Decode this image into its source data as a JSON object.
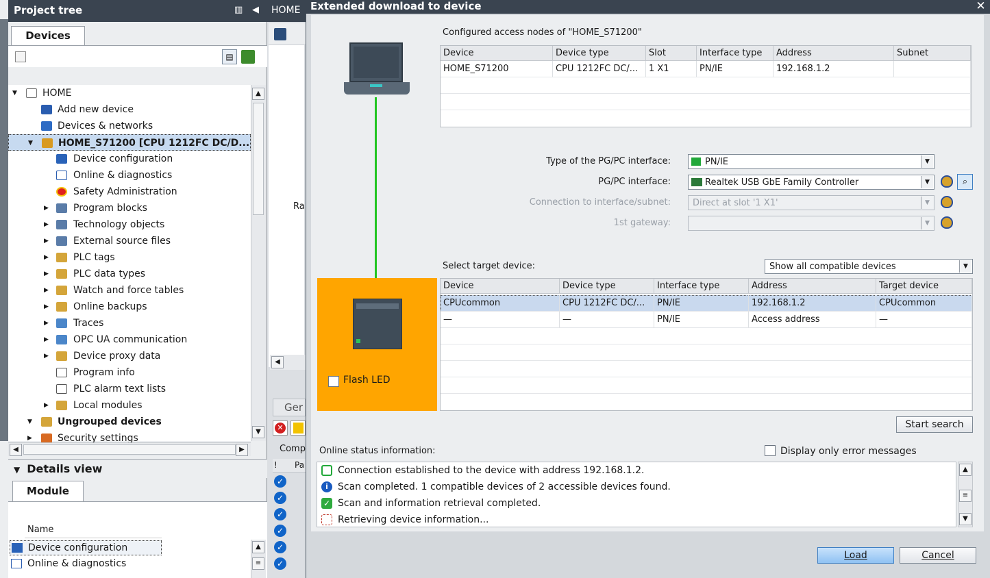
{
  "project_tree": {
    "title": "Project tree",
    "tab": "Devices",
    "items": [
      {
        "label": "HOME"
      },
      {
        "label": "Add new device"
      },
      {
        "label": "Devices & networks"
      },
      {
        "label": "HOME_S71200 [CPU 1212FC DC/D..."
      },
      {
        "label": "Device configuration"
      },
      {
        "label": "Online & diagnostics"
      },
      {
        "label": "Safety Administration"
      },
      {
        "label": "Program blocks"
      },
      {
        "label": "Technology objects"
      },
      {
        "label": "External source files"
      },
      {
        "label": "PLC tags"
      },
      {
        "label": "PLC data types"
      },
      {
        "label": "Watch and force tables"
      },
      {
        "label": "Online backups"
      },
      {
        "label": "Traces"
      },
      {
        "label": "OPC UA communication"
      },
      {
        "label": "Device proxy data"
      },
      {
        "label": "Program info"
      },
      {
        "label": "PLC alarm text lists"
      },
      {
        "label": "Local modules"
      },
      {
        "label": "Ungrouped devices"
      },
      {
        "label": "Security settings"
      }
    ]
  },
  "details_view": {
    "title": "Details view",
    "tab": "Module",
    "column": "Name",
    "rows": [
      "Device configuration",
      "Online & diagnostics"
    ]
  },
  "middle": {
    "tab_fragment": "HOME",
    "ra_fragment": "Ra",
    "gen_fragment": "Ger",
    "comp_fragment": "Comp",
    "col1": "!",
    "col2": "Pa"
  },
  "dialog": {
    "title": "Extended download to device",
    "configured_caption": "Configured access nodes of \"HOME_S71200\"",
    "configured_headers": [
      "Device",
      "Device type",
      "Slot",
      "Interface type",
      "Address",
      "Subnet"
    ],
    "configured_rows": [
      [
        "HOME_S71200",
        "CPU 1212FC DC/...",
        "1 X1",
        "PN/IE",
        "192.168.1.2",
        ""
      ]
    ],
    "pgpc_type_label": "Type of the PG/PC interface:",
    "pgpc_type_value": "PN/IE",
    "pgpc_iface_label": "PG/PC interface:",
    "pgpc_iface_value": "Realtek USB GbE Family Controller",
    "connection_label": "Connection to interface/subnet:",
    "connection_value": "Direct at slot '1 X1'",
    "gateway_label": "1st gateway:",
    "gateway_value": "",
    "select_target_label": "Select target device:",
    "filter_value": "Show all compatible devices",
    "target_headers": [
      "Device",
      "Device type",
      "Interface type",
      "Address",
      "Target device"
    ],
    "target_rows": [
      [
        "CPUcommon",
        "CPU 1212FC DC/...",
        "PN/IE",
        "192.168.1.2",
        "CPUcommon"
      ],
      [
        "—",
        "—",
        "PN/IE",
        "Access address",
        "—"
      ]
    ],
    "flash_led": "Flash LED",
    "start_search": "Start search",
    "online_status_label": "Online status information:",
    "only_errors": "Display only error messages",
    "status_messages": [
      {
        "text": "Connection established to the device with address 192.168.1.2.",
        "icon": "connection-icon"
      },
      {
        "text": "Scan completed. 1 compatible devices of 2 accessible devices found.",
        "icon": "info-icon"
      },
      {
        "text": "Scan and information retrieval completed.",
        "icon": "check-icon"
      },
      {
        "text": "Retrieving device information...",
        "icon": "retrieving-icon"
      }
    ],
    "load": "Load",
    "cancel": "Cancel"
  },
  "colors": {
    "title_bar": "#3a4450",
    "orange_panel": "#ffa500",
    "link_line": "#22c522",
    "selection": "#c9d9ee"
  }
}
